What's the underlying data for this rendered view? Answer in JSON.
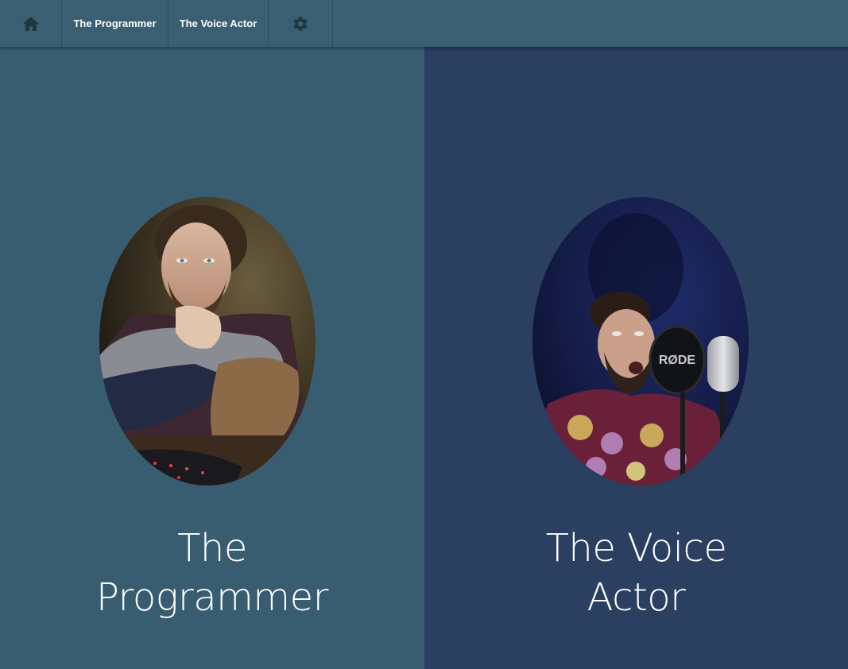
{
  "colors": {
    "navbar": "#3a5f72",
    "panel_left": "#385d70",
    "panel_right": "#2b3f60",
    "nav_icon": "#1e3744",
    "title_text": "#ffffff"
  },
  "navbar": {
    "home_icon": "home-icon",
    "items": [
      {
        "label": "The Programmer"
      },
      {
        "label": "The Voice Actor"
      }
    ],
    "settings_icon": "gear-icon"
  },
  "panels": {
    "left": {
      "title": "The Programmer",
      "image": "portrait of a man with beard resting chin on hand at a keyboard"
    },
    "right": {
      "title": "The Voice Actor",
      "image": "portrait of a man in floral shirt shouting into a studio microphone"
    }
  }
}
